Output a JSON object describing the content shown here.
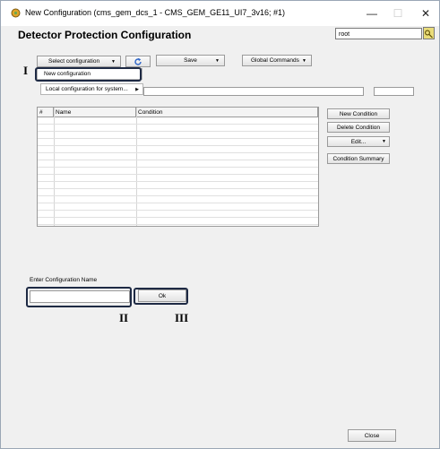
{
  "window": {
    "title": "New Configuration (cms_gem_dcs_1 - CMS_GEM_GE11_UI7_3v16; #1)",
    "minimize": "—",
    "maximize": "☐",
    "close": "✕"
  },
  "header": {
    "title": "Detector Protection Configuration",
    "user": "root"
  },
  "toolbar": {
    "select_config": "Select configuration",
    "save": "Save",
    "global_commands": "Global Commands"
  },
  "menu": {
    "items": [
      "New configuration",
      "Local configuration for system..."
    ]
  },
  "table": {
    "columns": [
      "#",
      "Name",
      "Condition"
    ]
  },
  "side_buttons": {
    "new_condition": "New Condition",
    "delete_condition": "Delete Condition",
    "edit": "Edit...",
    "condition_summary": "Condition Summary"
  },
  "config_name": {
    "label": "Enter Configuration Name",
    "value": "",
    "ok": "Ok"
  },
  "footer": {
    "close": "Close"
  },
  "annotations": {
    "one": "I",
    "two": "II",
    "three": "III"
  },
  "colors": {
    "annotation_border": "#1e2a44",
    "refresh_icon": "#2c64c8",
    "user_button": "#e9dc7a"
  }
}
